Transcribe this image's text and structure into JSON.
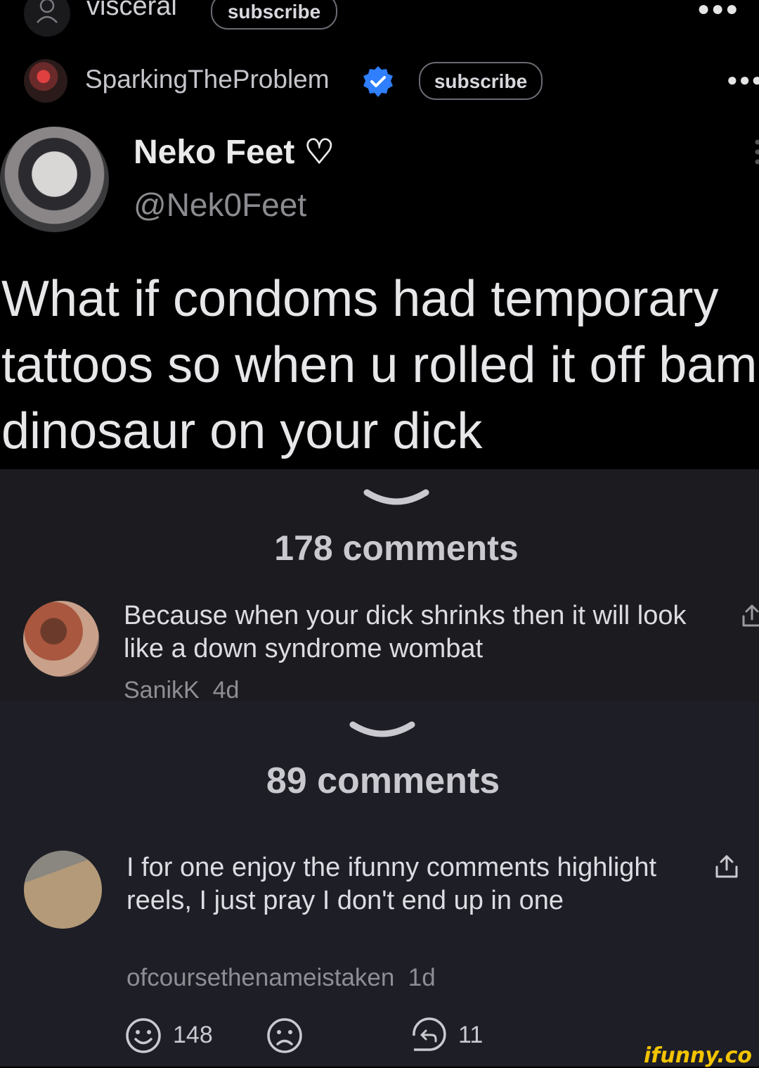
{
  "top_header": {
    "channel_name": "visceral",
    "subscribe_label": "subscribe"
  },
  "post_header": {
    "author_name": "SparkingTheProblem",
    "subscribe_label": "subscribe"
  },
  "tweet": {
    "display_name": "Neko Feet ♡",
    "handle": "@Nek0Feet",
    "text": "What if condoms had temporary tattoos so when u rolled it off bam dinosaur on your dick"
  },
  "section1": {
    "comments_count": "178 comments",
    "comment": {
      "text": "Because when your dick shrinks then it will look like a down syndrome wombat",
      "author": "SanikK",
      "age": "4d"
    }
  },
  "section2": {
    "comments_count": "89 comments",
    "comment": {
      "text": "I for one enjoy the ifunny comments highlight reels, I just pray I don't end up in one",
      "author": "ofcoursethenameistaken",
      "age": "1d",
      "smile_count": "148",
      "reply_count": "11"
    }
  },
  "watermark": "ifunny.co",
  "colors": {
    "verified_blue": "#2f7fff",
    "watermark_yellow": "#f2c300"
  }
}
